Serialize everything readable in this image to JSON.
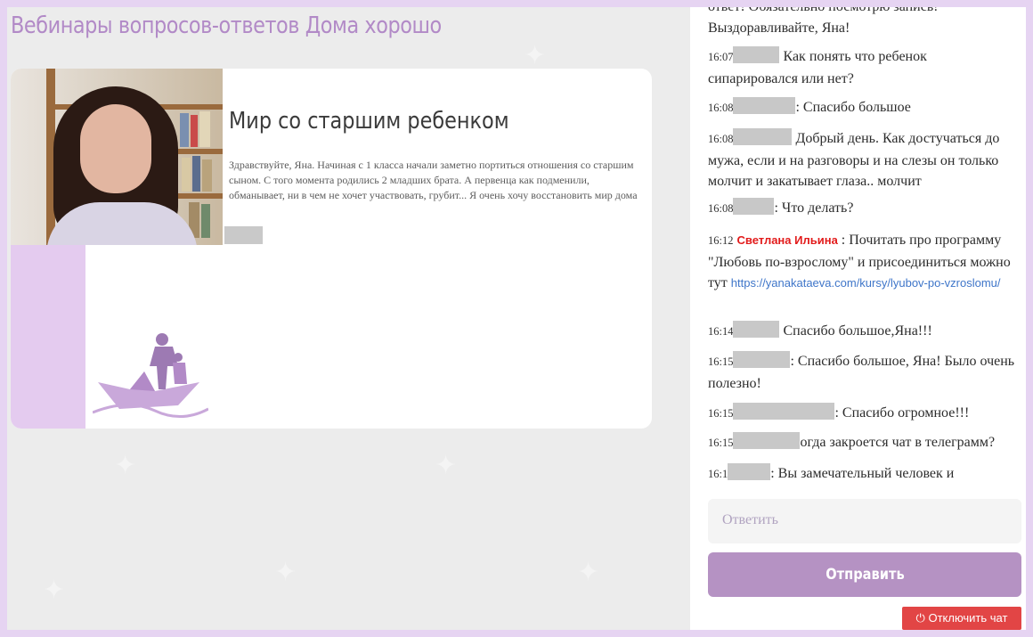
{
  "page_title": "Вебинары вопросов-ответов Дома хорошо",
  "slide": {
    "heading": "Мир со старшим ребенком",
    "text": "Здравствуйте, Яна. Начиная с 1 класса начали заметно портиться отношения со старшим сыном. С того момента родились 2 младших брата. А первенца как подменили, обманывает, ни в чем не хочет участвовать, грубит... Я очень хочу восстановить мир дома"
  },
  "chat": {
    "messages": [
      {
        "time": "",
        "author": "",
        "text": "ответ! Обязательно посмотрю запись! Выздоравливайте, Яна!"
      },
      {
        "time": "16:07",
        "author": "",
        "text": "Как понять что ребенок сипарировался или нет?"
      },
      {
        "time": "16:08",
        "author": "",
        "text": ": Спасибо большое"
      },
      {
        "time": "16:08",
        "author": "",
        "text": "Добрый день. Как достучаться до мужа, если и на разговоры и на слезы он только молчит и закатывает глаза.. молчит"
      },
      {
        "time": "16:08",
        "author": "",
        "text": ": Что делать?"
      },
      {
        "time": "16:12",
        "author": "Светлана Ильина",
        "text": ": Почитать про программу \"Любовь по-взрослому\" и присоединиться можно тут",
        "link": "https://yanakataeva.com/kursy/lyubov-po-vzroslomu/"
      },
      {
        "time": "16:14",
        "author": "",
        "text": "Спасибо большое,Яна!!!"
      },
      {
        "time": "16:15",
        "author": "",
        "text": ": Спасибо большое, Яна! Было очень полезно!"
      },
      {
        "time": "16:15",
        "author": "",
        "text": ": Спасибо огромное!!!"
      },
      {
        "time": "16:15",
        "author": "",
        "text": "огда закроется чат в телеграмм?"
      },
      {
        "time": "16:1",
        "author": "",
        "text": ": Вы замечательный человек и"
      }
    ],
    "reply_placeholder": "Ответить",
    "send_label": "Отправить",
    "disable_label": "Отключить чат"
  },
  "colors": {
    "accent": "#b592c3",
    "frame": "#e6d4f2",
    "author": "#e21b1b",
    "link": "#3f76c9",
    "disable": "#e24545"
  },
  "icons": [
    "power-icon"
  ]
}
